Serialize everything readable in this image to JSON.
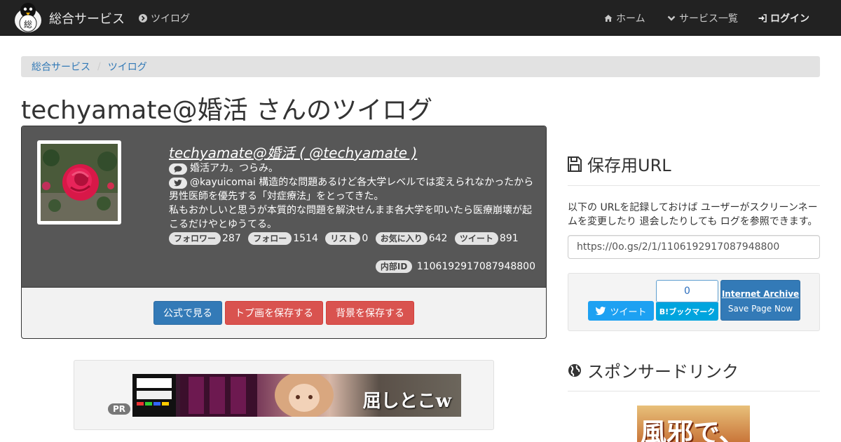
{
  "navbar": {
    "brand": "総合サービス",
    "logo_char": "総",
    "twilog_link": "ツイログ",
    "home": "ホーム",
    "services": "サービス一覧",
    "login": "ログイン"
  },
  "breadcrumb": {
    "items": [
      "総合サービス",
      "ツイログ"
    ]
  },
  "page_title": "techyamate@婚活 さんのツイログ",
  "profile": {
    "display_name": "techyamate@婚活 ( @techyamate )",
    "bio_line1": "婚活アカ。つらみ。",
    "bio_line2": "@kayuicomai 構造的な問題あるけど各大学レベルでは変えられなかったから男性医師を優先する「対症療法」をとってきた。",
    "bio_line3": "私もおかしいと思うが本質的な問題を解決せんまま各大学を叩いたら医療崩壊が起こるだけやとゆうてる。",
    "stats": {
      "follower_label": "フォロワー",
      "follower": "287",
      "follow_label": "フォロー",
      "follow": "1514",
      "list_label": "リスト",
      "list": "0",
      "fav_label": "お気に入り",
      "fav": "642",
      "tweet_label": "ツイート",
      "tweet": "891"
    },
    "internal_id_label": "内部ID",
    "internal_id": "1106192917087948800",
    "buttons": {
      "official": "公式で見る",
      "save_icon": "トプ画を保存する",
      "save_bg": "背景を保存する"
    }
  },
  "ad": {
    "pr_label": "PR",
    "banner_text": "屈しとこw"
  },
  "save_section": {
    "heading": "保存用URL",
    "description": "以下の URLを記録しておけば ユーザーがスクリーンネームを変更したり 退会したりしても ログを参照できます。",
    "url": "https://0o.gs/2/1/1106192917087948800",
    "tweet_button": "ツイート",
    "hatena_count": "0",
    "hatena_label": "B!ブックマーク",
    "ia_title": "Internet Archive",
    "ia_sub": "Save Page Now"
  },
  "sponsor": {
    "heading": "スポンサードリンク",
    "banner_text": "風邪で、"
  },
  "colors": {
    "navbar_bg": "#222222",
    "link_blue": "#337ab7",
    "danger_red": "#d9534f",
    "panel_dark": "#575757",
    "twitter_blue": "#1da1f2",
    "hatena_blue": "#00a4de"
  }
}
